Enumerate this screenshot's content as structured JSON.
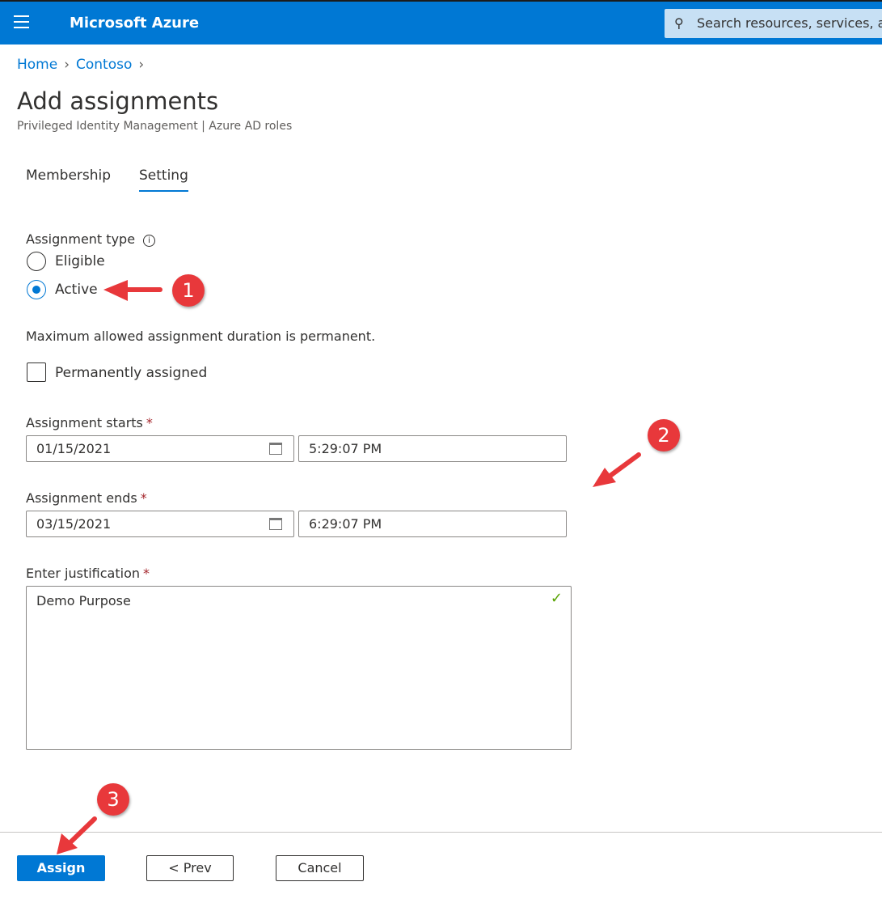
{
  "header": {
    "app_title": "Microsoft Azure",
    "search_placeholder": "Search resources, services, and docs"
  },
  "breadcrumb": [
    "Home",
    "Contoso"
  ],
  "page": {
    "title": "Add assignments",
    "subtitle": "Privileged Identity Management | Azure AD roles"
  },
  "tabs": [
    {
      "label": "Membership",
      "active": false
    },
    {
      "label": "Setting",
      "active": true
    }
  ],
  "form": {
    "assignment_type_label": "Assignment type",
    "options": [
      {
        "label": "Eligible",
        "selected": false
      },
      {
        "label": "Active",
        "selected": true
      }
    ],
    "duration_note": "Maximum allowed assignment duration is permanent.",
    "permanent_label": "Permanently assigned",
    "permanent_checked": false,
    "starts_label": "Assignment starts",
    "start_date": "01/15/2021",
    "start_time": "5:29:07 PM",
    "ends_label": "Assignment ends",
    "end_date": "03/15/2021",
    "end_time": "6:29:07 PM",
    "justification_label": "Enter justification",
    "justification": "Demo Purpose",
    "required_mark": "*"
  },
  "footer": {
    "assign": "Assign",
    "prev": "< Prev",
    "cancel": "Cancel"
  },
  "annotations": [
    "1",
    "2",
    "3"
  ],
  "colors": {
    "brand": "#0078d4",
    "annotation": "#e8383b",
    "valid": "#57a300"
  }
}
